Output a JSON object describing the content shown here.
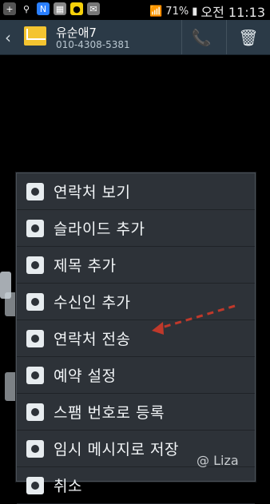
{
  "status": {
    "battery": "71%",
    "time": "오전 11:13"
  },
  "contact": {
    "name": "유순애7",
    "phone": "010-4308-5381"
  },
  "menu": {
    "items": [
      {
        "label": "연락처 보기",
        "icon": "contact-card-icon"
      },
      {
        "label": "슬라이드 추가",
        "icon": "add-slide-icon"
      },
      {
        "label": "제목 추가",
        "icon": "add-title-icon"
      },
      {
        "label": "수신인 추가",
        "icon": "add-recipient-icon"
      },
      {
        "label": "연락처 전송",
        "icon": "send-contact-icon"
      },
      {
        "label": "예약 설정",
        "icon": "schedule-message-icon"
      },
      {
        "label": "스팸 번호로 등록",
        "icon": "block-spam-icon"
      },
      {
        "label": "임시 메시지로 저장",
        "icon": "save-draft-icon"
      },
      {
        "label": "취소",
        "icon": "cancel-icon"
      }
    ]
  },
  "watermark": "@ Liza",
  "colors": {
    "appbar": "#2b3a47",
    "menu_bg": "#2d3238",
    "arrow": "#c0392b"
  }
}
